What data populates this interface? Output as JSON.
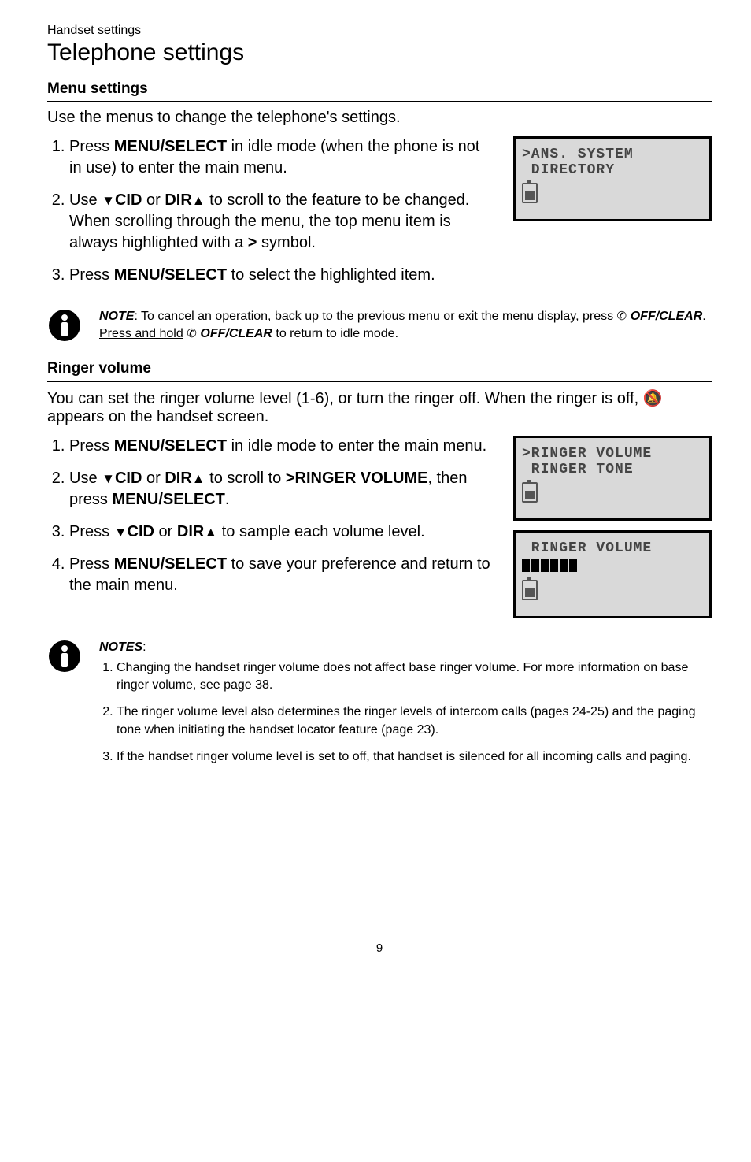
{
  "breadcrumb": "Handset settings",
  "title": "Telephone settings",
  "sectionA": {
    "heading": "Menu settings",
    "lead": "Use the menus to change the telephone's settings.",
    "steps": [
      {
        "pre": "Press ",
        "key": "MENU/",
        "keysc": "SELECT",
        "post": " in idle mode (when the phone is not in use) to enter the main menu."
      },
      {
        "pre": "Use ",
        "key1": "CID",
        "mid": " or ",
        "key2": "DIR",
        "post": " to scroll to the feature to be changed. When scrolling through the menu, the top menu item is always highlighted with a ",
        "sym": ">",
        "post2": " symbol."
      },
      {
        "pre": "Press ",
        "keysc": "MENU",
        "key": "/SELECT",
        "post": " to select the highlighted item."
      }
    ]
  },
  "lcd1": {
    "line1": ">ANS. SYSTEM",
    "line2": " DIRECTORY"
  },
  "note1": {
    "label": "NOTE",
    "text1": ": To cancel an operation, back up to the previous menu or exit the menu display, press ",
    "keysc1": "OFF",
    "key1": "/CLEAR",
    "text2": ". ",
    "underline": "Press and hold",
    "text3": " ",
    "keysc2": "OFF",
    "key2": "/CLEAR",
    "text4": " to return to idle mode."
  },
  "sectionB": {
    "heading": "Ringer volume",
    "lead1": "You can set the ringer volume level (1-6), or turn the ringer off. When the ringer is off, ",
    "lead2": " appears on the handset screen.",
    "steps": [
      {
        "pre": "Press ",
        "key": "MENU/",
        "keysc": "SELECT",
        "post": " in idle mode to enter the main menu."
      },
      {
        "pre": "Use ",
        "key1": "CID",
        "mid": " or ",
        "key2": "DIR",
        "post1": " to scroll to ",
        "target": ">RINGER VOLUME",
        "post2": ", then press ",
        "keysc2": "MENU",
        "key3": "/SELECT",
        "post3": "."
      },
      {
        "pre": "Press ",
        "key1": "CID",
        "mid": " or ",
        "key2": "DIR",
        "post": " to sample each volume level."
      },
      {
        "pre": "Press ",
        "keysc": "MENU",
        "key": "/SELECT",
        "post": " to save your preference and return to the main menu."
      }
    ]
  },
  "lcd2": {
    "line1": ">RINGER VOLUME",
    "line2": " RINGER TONE"
  },
  "lcd3": {
    "line1": " RINGER VOLUME"
  },
  "notes2": {
    "label": "NOTES",
    "items": [
      "Changing the handset ringer volume does not affect base ringer volume. For more information on base ringer volume, see page 38.",
      "The ringer volume level also determines the ringer levels of intercom calls (pages 24-25) and the paging tone when initiating the handset locator feature (page 23).",
      "If the handset ringer volume level is set to off, that handset is silenced for all incoming calls and paging."
    ]
  },
  "page_number": "9"
}
